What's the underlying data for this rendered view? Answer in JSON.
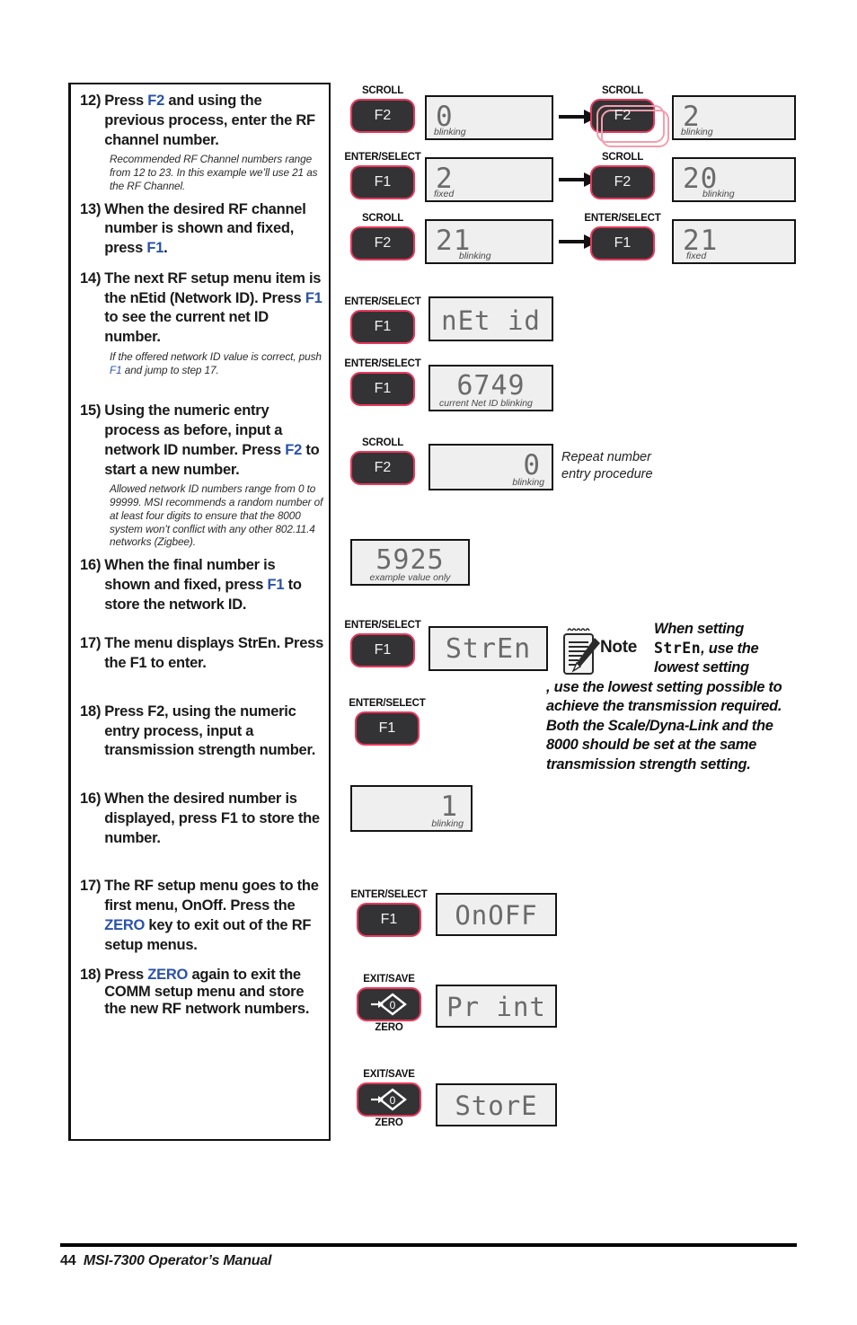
{
  "page": {
    "footer_page_number": "44",
    "footer_title": "MSI-7300 Operator’s Manual"
  },
  "colors": {
    "key_accent": "#2a52a8",
    "button_border": "#e8385c",
    "button_face": "#333234",
    "lcd_face": "#efefef",
    "lcd_glyph": "#6b6b6b"
  },
  "steps": [
    {
      "num": "12)",
      "text_parts": [
        "Press ",
        "F2",
        " and using the previous process, enter the RF channel number."
      ],
      "italic_note": "Recommended RF Channel numbers range from 12 to 23. In this example we’ll use 21 as the RF Channel."
    },
    {
      "num": "13)",
      "text_parts": [
        "When the desired RF channel number is shown and fixed, press ",
        "F1",
        "."
      ],
      "italic_note": ""
    },
    {
      "num": "14)",
      "text_parts": [
        "The next RF setup menu item is the ",
        "nEtid",
        " (Network ID). Press ",
        "F1",
        " to see the current net ID number."
      ],
      "italic_note": "If the offered network ID value is correct, push F1 and jump to step 17."
    },
    {
      "num": "15)",
      "text_parts": [
        "Using the numeric entry process as before, input a network ID number. Press ",
        "F2",
        " to start a new number."
      ],
      "italic_note": "Allowed network ID numbers range from 0 to 99999. MSI recommends a random number of at least four digits to ensure that the 8000 system won’t conflict with any other 802.11.4 networks (Zigbee)."
    },
    {
      "num": "16)",
      "text_parts": [
        "When the final number is shown and fixed, press ",
        "F1",
        " to store the network ID."
      ],
      "italic_note": ""
    },
    {
      "num": "17)",
      "text_parts": [
        "The menu displays StrEn. Press the F1 to enter."
      ],
      "italic_note": ""
    },
    {
      "num": "18)",
      "text_parts": [
        "Press F2, using the numeric entry process, input a transmission strength number."
      ],
      "italic_note": ""
    },
    {
      "num": "16)",
      "text_parts": [
        "When the desired number is displayed, press F1 to store the number."
      ],
      "italic_note": ""
    },
    {
      "num": "17)",
      "text_parts": [
        "The RF setup menu goes to the first menu, ",
        "OnOff",
        ". Press the ",
        "ZERO",
        " key to exit out of the RF setup menus."
      ],
      "italic_note": ""
    },
    {
      "num": "18)",
      "text_parts": [
        "Press ",
        "ZERO",
        " again to exit the COMM setup menu and store the new RF network numbers."
      ],
      "italic_note": ""
    }
  ],
  "step_text": {
    "s12_a": "Press ",
    "s12_key": "F2",
    "s12_b": " and using the previous process, enter the RF channel number.",
    "s12_note": "Recommended RF Channel numbers range from 12 to 23. In this example we’ll use 21 as the RF Channel.",
    "s13_a": "When the desired RF channel number is shown and fixed, press ",
    "s13_key": "F1",
    "s13_b": ".",
    "s14_a": "The next RF setup menu item is the ",
    "s14_bold": "nEtid",
    "s14_b": " (Network ID). Press ",
    "s14_key": "F1",
    "s14_c": " to see the current net ID number.",
    "s14_note_a": "If the offered network ID value is correct, push ",
    "s14_note_key": "F1",
    "s14_note_b": " and jump to step 17.",
    "s15_a": "Using the numeric entry process as before, input a network ID number. Press ",
    "s15_key": "F2",
    "s15_b": " to start a new number.",
    "s15_note": "Allowed network ID numbers range from 0 to 99999. MSI recommends a random number of at least four digits to ensure that the 8000 system won’t conflict with any other 802.11.4 networks (Zigbee).",
    "s16_a": "When the final number is shown and fixed, press ",
    "s16_key": "F1",
    "s16_b": " to store the network ID.",
    "s17_a": "The menu displays StrEn. Press the F1 to enter.",
    "s18_a": "Press F2, using the numeric entry process, input a transmission strength number.",
    "s16b_a": "When the desired number is displayed, press F1 to store the number.",
    "s17b_a": "The RF setup menu goes to the first menu, ",
    "s17b_bold": "OnOff",
    "s17b_b": ". Press the ",
    "s17b_key": "ZERO",
    "s17b_c": " key to exit out of the RF setup menus.",
    "s18b_a": "Press ",
    "s18b_key": "ZERO",
    "s18b_b": " again to exit the COMM setup menu and store the new RF network numbers."
  },
  "diagram": {
    "buttons": [
      {
        "id": "b1",
        "top_label": "SCROLL",
        "key": "F2",
        "bottom_label": ""
      },
      {
        "id": "b2",
        "top_label": "SCROLL",
        "key": "F2",
        "bottom_label": ""
      },
      {
        "id": "b3",
        "top_label": "ENTER/SELECT",
        "key": "F1",
        "bottom_label": ""
      },
      {
        "id": "b4",
        "top_label": "SCROLL",
        "key": "F2",
        "bottom_label": ""
      },
      {
        "id": "b5",
        "top_label": "SCROLL",
        "key": "F2",
        "bottom_label": ""
      },
      {
        "id": "b6",
        "top_label": "ENTER/SELECT",
        "key": "F1",
        "bottom_label": ""
      },
      {
        "id": "b7",
        "top_label": "ENTER/SELECT",
        "key": "F1",
        "bottom_label": ""
      },
      {
        "id": "b8",
        "top_label": "ENTER/SELECT",
        "key": "F1",
        "bottom_label": ""
      },
      {
        "id": "b9",
        "top_label": "SCROLL",
        "key": "F2",
        "bottom_label": ""
      },
      {
        "id": "b10",
        "top_label": "ENTER/SELECT",
        "key": "F1",
        "bottom_label": ""
      },
      {
        "id": "b11",
        "top_label": "ENTER/SELECT",
        "key": "F1",
        "bottom_label": ""
      },
      {
        "id": "b12",
        "top_label": "ENTER/SELECT",
        "key": "F1",
        "bottom_label": ""
      },
      {
        "id": "b13",
        "top_label": "EXIT/SAVE",
        "key": "ZERO-ICON",
        "bottom_label": "ZERO"
      },
      {
        "id": "b14",
        "top_label": "EXIT/SAVE",
        "key": "ZERO-ICON",
        "bottom_label": "ZERO"
      }
    ],
    "displays": [
      {
        "id": "d1",
        "value": "0",
        "caption": "blinking",
        "align": "left"
      },
      {
        "id": "d2",
        "value": "2",
        "caption": "blinking",
        "align": "left"
      },
      {
        "id": "d3",
        "value": "2",
        "caption": "fixed",
        "align": "left"
      },
      {
        "id": "d4",
        "value": "20",
        "caption": "blinking",
        "align": "left"
      },
      {
        "id": "d5",
        "value": "21",
        "caption": "blinking",
        "align": "left"
      },
      {
        "id": "d6",
        "value": "21",
        "caption": "fixed",
        "align": "left"
      },
      {
        "id": "d7",
        "value": "nEt id",
        "caption": "",
        "align": "center"
      },
      {
        "id": "d8",
        "value": "6749",
        "caption": "current Net ID blinking",
        "align": "center"
      },
      {
        "id": "d9",
        "value": "0",
        "caption": "blinking",
        "align": "right"
      },
      {
        "id": "d10",
        "value": "5925",
        "caption": "example value only",
        "align": "center"
      },
      {
        "id": "d11",
        "value": "StrEn",
        "caption": "",
        "align": "center"
      },
      {
        "id": "d12",
        "value": "1",
        "caption": "blinking",
        "align": "right"
      },
      {
        "id": "d13",
        "value": "OnOFF",
        "caption": "",
        "align": "center"
      },
      {
        "id": "d14",
        "value": "Pr int",
        "caption": "",
        "align": "center"
      },
      {
        "id": "d15",
        "value": "StorE",
        "caption": "",
        "align": "center"
      }
    ],
    "annotations": {
      "repeat_procedure": "Repeat number\nentry procedure",
      "repeat_line1": "Repeat number",
      "repeat_line2": "entry procedure"
    },
    "note": {
      "label": "Note",
      "text_a": "When setting ",
      "text_seg": "StrEn",
      "text_b": ", use the lowest setting possible to achieve the transmission required. Both the Scale/Dyna-Link and the 8000 should be set at the same transmission strength setting."
    }
  }
}
